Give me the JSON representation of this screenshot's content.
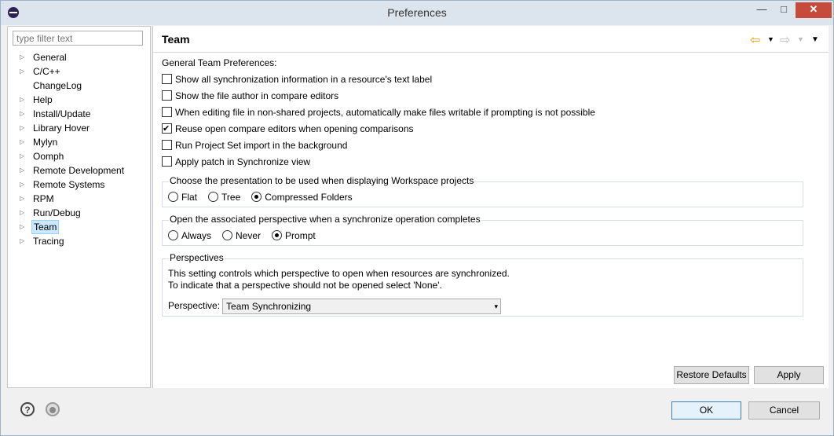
{
  "window": {
    "title": "Preferences",
    "minimize": "—",
    "maximize": "□",
    "close": "✕"
  },
  "filter": {
    "placeholder": "type filter text"
  },
  "tree": [
    {
      "label": "General",
      "expandable": true
    },
    {
      "label": "C/C++",
      "expandable": true
    },
    {
      "label": "ChangeLog",
      "expandable": false
    },
    {
      "label": "Help",
      "expandable": true
    },
    {
      "label": "Install/Update",
      "expandable": true
    },
    {
      "label": "Library Hover",
      "expandable": true
    },
    {
      "label": "Mylyn",
      "expandable": true
    },
    {
      "label": "Oomph",
      "expandable": true
    },
    {
      "label": "Remote Development",
      "expandable": true
    },
    {
      "label": "Remote Systems",
      "expandable": true
    },
    {
      "label": "RPM",
      "expandable": true
    },
    {
      "label": "Run/Debug",
      "expandable": true
    },
    {
      "label": "Team",
      "expandable": true,
      "selected": true
    },
    {
      "label": "Tracing",
      "expandable": true
    }
  ],
  "page": {
    "title": "Team",
    "section_label": "General Team Preferences:",
    "checkboxes": [
      {
        "label": "Show all synchronization information in a resource's text label",
        "checked": false
      },
      {
        "label": "Show the file author in compare editors",
        "checked": false
      },
      {
        "label": "When editing file in non-shared projects, automatically make files writable if prompting is not possible",
        "checked": false
      },
      {
        "label": "Reuse open compare editors when opening comparisons",
        "checked": true
      },
      {
        "label": "Run Project Set import in the background",
        "checked": false
      },
      {
        "label": "Apply patch in Synchronize view",
        "checked": false
      }
    ],
    "presentation_group": {
      "title": "Choose the presentation to be used when displaying Workspace projects",
      "options": [
        "Flat",
        "Tree",
        "Compressed Folders"
      ],
      "selected": "Compressed Folders"
    },
    "perspective_group": {
      "title": "Open the associated perspective when a synchronize operation completes",
      "options": [
        "Always",
        "Never",
        "Prompt"
      ],
      "selected": "Prompt"
    },
    "perspectives": {
      "title": "Perspectives",
      "line1": "This setting controls which perspective to open when resources are synchronized.",
      "line2": "To indicate that a perspective should not be opened select 'None'.",
      "combo_label": "Perspective:",
      "combo_value": "Team Synchronizing"
    },
    "restore_defaults": "Restore Defaults",
    "apply": "Apply"
  },
  "footer": {
    "ok": "OK",
    "cancel": "Cancel",
    "help_glyph": "?"
  },
  "icons": {
    "back": "⇦",
    "forward": "⇨",
    "menu": "▼",
    "dropdown": "▾",
    "help": "help-icon",
    "import_export": "record-icon",
    "app": "eclipse-icon"
  },
  "colors": {
    "titlebar": "#dce4ee",
    "close": "#c74b3a",
    "selection": "#cce8ff",
    "back_arrow": "#e8a400"
  }
}
